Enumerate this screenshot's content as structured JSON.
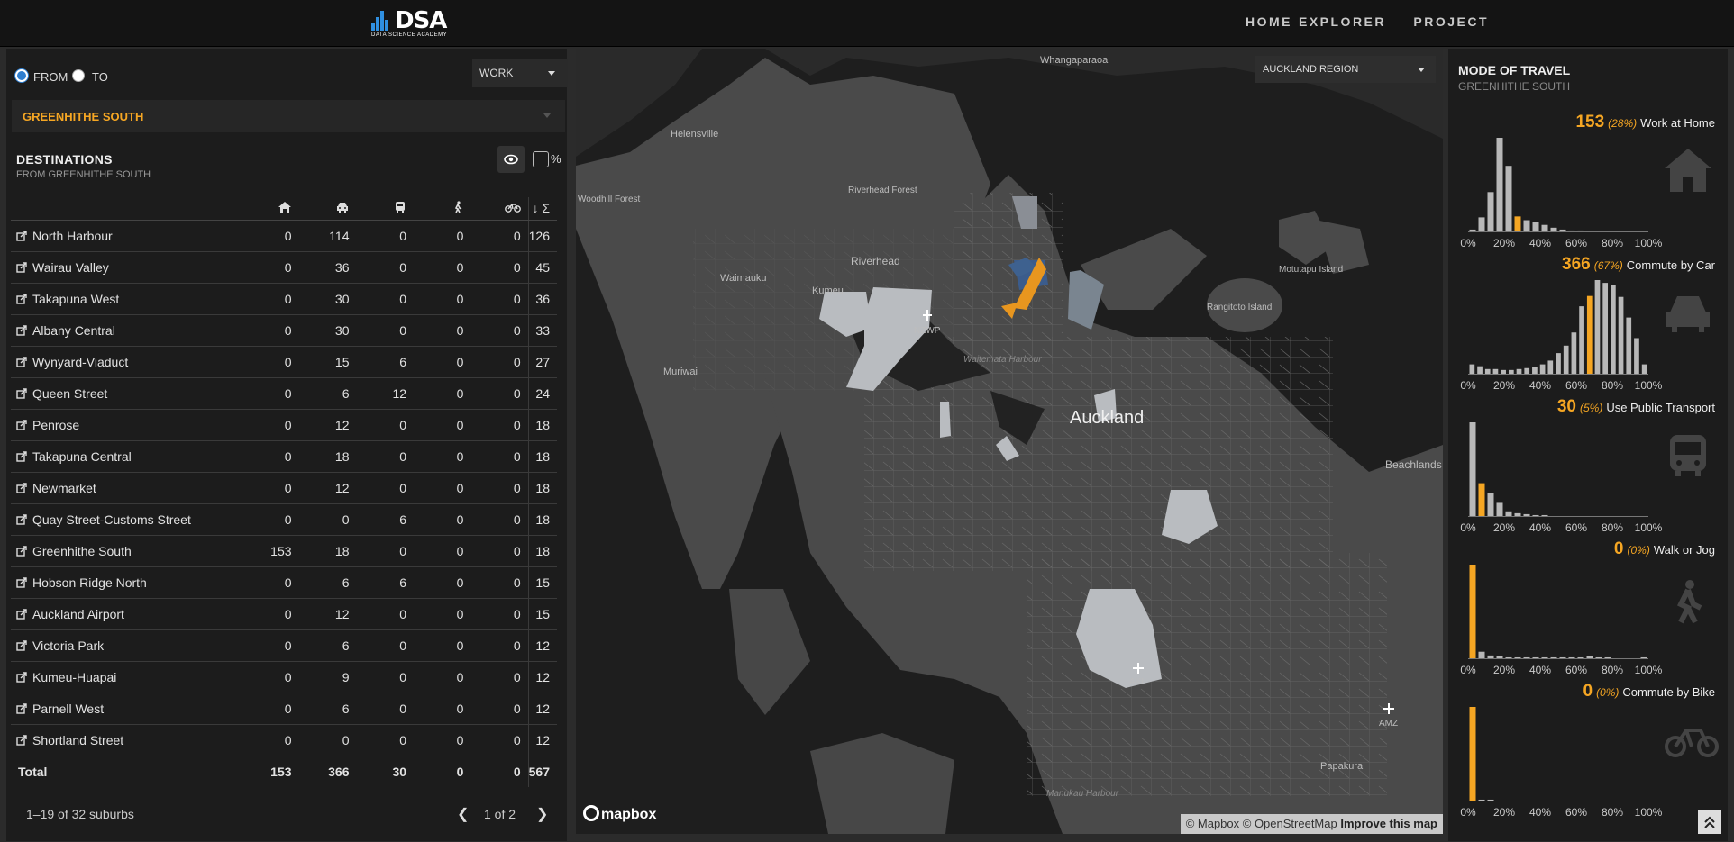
{
  "header": {
    "logo_text": "DSA",
    "logo_subtitle": "DATA SCIENCE ACADEMY",
    "nav": [
      "HOME",
      "EXPLORER",
      "PROJECT"
    ]
  },
  "filters": {
    "from_label": "FROM",
    "to_label": "TO",
    "direction_selected": "FROM",
    "purpose": "WORK",
    "suburb": "GREENHITHE SOUTH"
  },
  "destinations": {
    "title": "DESTINATIONS",
    "subtitle": "FROM GREENHITHE SOUTH",
    "percent_label": "%",
    "column_icons": [
      "home-icon",
      "car-icon",
      "bus-icon",
      "walk-icon",
      "bike-icon"
    ],
    "sum_header": "↓ Σ",
    "rows": [
      {
        "name": "North Harbour",
        "home": "0",
        "car": "114",
        "pt": "0",
        "walk": "0",
        "bike": "0",
        "total": "126"
      },
      {
        "name": "Wairau Valley",
        "home": "0",
        "car": "36",
        "pt": "0",
        "walk": "0",
        "bike": "0",
        "total": "45"
      },
      {
        "name": "Takapuna West",
        "home": "0",
        "car": "30",
        "pt": "0",
        "walk": "0",
        "bike": "0",
        "total": "36"
      },
      {
        "name": "Albany Central",
        "home": "0",
        "car": "30",
        "pt": "0",
        "walk": "0",
        "bike": "0",
        "total": "33"
      },
      {
        "name": "Wynyard-Viaduct",
        "home": "0",
        "car": "15",
        "pt": "6",
        "walk": "0",
        "bike": "0",
        "total": "27"
      },
      {
        "name": "Queen Street",
        "home": "0",
        "car": "6",
        "pt": "12",
        "walk": "0",
        "bike": "0",
        "total": "24"
      },
      {
        "name": "Penrose",
        "home": "0",
        "car": "12",
        "pt": "0",
        "walk": "0",
        "bike": "0",
        "total": "18"
      },
      {
        "name": "Takapuna Central",
        "home": "0",
        "car": "18",
        "pt": "0",
        "walk": "0",
        "bike": "0",
        "total": "18"
      },
      {
        "name": "Newmarket",
        "home": "0",
        "car": "12",
        "pt": "0",
        "walk": "0",
        "bike": "0",
        "total": "18"
      },
      {
        "name": "Quay Street-Customs Street",
        "home": "0",
        "car": "0",
        "pt": "6",
        "walk": "0",
        "bike": "0",
        "total": "18"
      },
      {
        "name": "Greenhithe South",
        "home": "153",
        "car": "18",
        "pt": "0",
        "walk": "0",
        "bike": "0",
        "total": "18"
      },
      {
        "name": "Hobson Ridge North",
        "home": "0",
        "car": "6",
        "pt": "6",
        "walk": "0",
        "bike": "0",
        "total": "15"
      },
      {
        "name": "Auckland Airport",
        "home": "0",
        "car": "12",
        "pt": "0",
        "walk": "0",
        "bike": "0",
        "total": "15"
      },
      {
        "name": "Victoria Park",
        "home": "0",
        "car": "6",
        "pt": "0",
        "walk": "0",
        "bike": "0",
        "total": "12"
      },
      {
        "name": "Kumeu-Huapai",
        "home": "0",
        "car": "9",
        "pt": "0",
        "walk": "0",
        "bike": "0",
        "total": "12"
      },
      {
        "name": "Parnell West",
        "home": "0",
        "car": "6",
        "pt": "0",
        "walk": "0",
        "bike": "0",
        "total": "12"
      },
      {
        "name": "Shortland Street",
        "home": "0",
        "car": "0",
        "pt": "0",
        "walk": "0",
        "bike": "0",
        "total": "12"
      }
    ],
    "total": {
      "name": "Total",
      "home": "153",
      "car": "366",
      "pt": "30",
      "walk": "0",
      "bike": "0",
      "total": "567"
    },
    "pager": {
      "summary": "1–19 of 32 suburbs",
      "page": "1 of 2",
      "prev": "❮",
      "next": "❯"
    }
  },
  "map": {
    "region": "AUCKLAND REGION",
    "labels": [
      "Whangaparaoa",
      "Helensville",
      "Woodhill Forest",
      "Riverhead Forest",
      "Waimauku",
      "Kumeu",
      "Riverhead",
      "NZWP",
      "Muriwai",
      "Waitemata Harbour",
      "Motutapu Island",
      "Rangitoto Island",
      "Auckland",
      "Beachlands",
      "AKL",
      "AMZ",
      "Papakura",
      "Manukau Harbour"
    ],
    "logo": "mapbox",
    "attribution": "© Mapbox © OpenStreetMap",
    "improve": "Improve this map",
    "colors": {
      "land": "#4a4a4a",
      "water": "#1e1e1e",
      "selected": "#e8961f",
      "highlight": "#3b5c8c",
      "light": "#b9bcc0"
    }
  },
  "mode_of_travel": {
    "title": "MODE OF TRAVEL",
    "subtitle": "GREENHITHE SOUTH",
    "accent": "#f5a623",
    "axis_ticks": [
      "0%",
      "20%",
      "40%",
      "60%",
      "80%",
      "100%"
    ],
    "modes": [
      {
        "count": "153",
        "pct": "(28%)",
        "label": "Work at Home",
        "icon": "home-icon",
        "bins": [
          2,
          15,
          42,
          100,
          70,
          16,
          12,
          10,
          7,
          4,
          2,
          1,
          1,
          0,
          0,
          0,
          0,
          0,
          0,
          0
        ],
        "highlight": 5
      },
      {
        "count": "366",
        "pct": "(67%)",
        "label": "Commute by Car",
        "icon": "car-icon",
        "bins": [
          10,
          8,
          5,
          5,
          4,
          4,
          5,
          6,
          7,
          10,
          14,
          22,
          30,
          44,
          72,
          83,
          100,
          97,
          95,
          82,
          60,
          38,
          10
        ],
        "highlight": 15
      },
      {
        "count": "30",
        "pct": "(5%)",
        "label": "Use Public Transport",
        "icon": "train-icon",
        "bins": [
          100,
          35,
          25,
          14,
          5,
          3,
          2,
          1,
          1,
          0,
          0,
          0,
          0,
          0,
          0,
          0,
          0,
          0,
          0,
          0
        ],
        "highlight": 1
      },
      {
        "count": "0",
        "pct": "(0%)",
        "label": "Walk or Jog",
        "icon": "walk-icon",
        "bins": [
          100,
          7,
          3,
          2,
          1,
          1,
          1,
          1,
          1,
          1,
          1,
          1,
          1,
          2,
          1,
          1,
          0,
          0,
          0,
          1
        ],
        "highlight": 0
      },
      {
        "count": "0",
        "pct": "(0%)",
        "label": "Commute by Bike",
        "icon": "bike-icon",
        "bins": [
          100,
          1,
          1,
          0,
          0,
          0,
          0,
          0,
          0,
          0,
          0,
          0,
          0,
          0,
          0,
          0,
          0,
          0,
          0,
          0
        ],
        "highlight": 0
      }
    ]
  }
}
